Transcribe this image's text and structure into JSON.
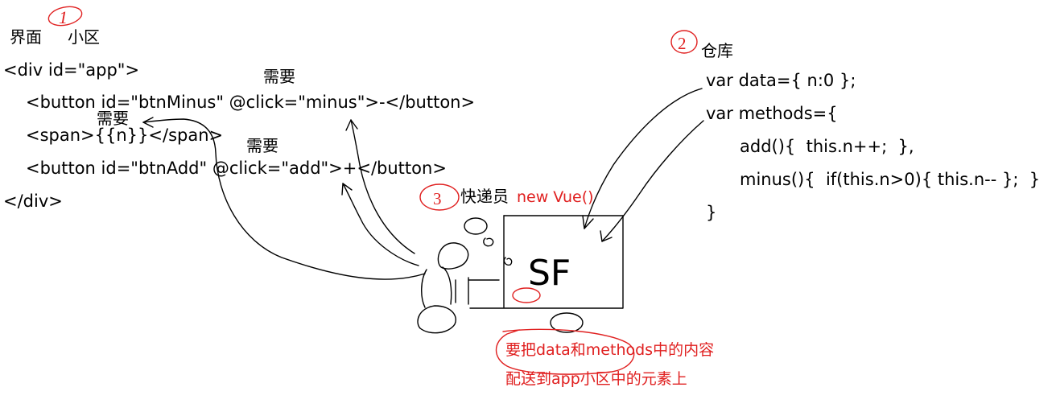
{
  "left": {
    "title_ui": "界面",
    "title_area": "小区",
    "code": [
      "<div id=\"app\">",
      "<button id=\"btnMinus\" @click=\"minus\">-</button>",
      "<span>{{n}}</span>",
      "<button id=\"btnAdd\" @click=\"add\">+</button>",
      "</div>"
    ],
    "need_labels": [
      "需要",
      "需要",
      "需要"
    ]
  },
  "right": {
    "title": "仓库",
    "code": [
      "var data={ n:0 };",
      "var methods={",
      "add(){  this.n++;  },",
      "minus(){  if(this.n>0){ this.n-- };  }",
      "}"
    ]
  },
  "courier": {
    "label": "快递员",
    "new_vue": "new Vue()",
    "box_text": "SF"
  },
  "note": {
    "line1": "要把data和methods中的内容",
    "line2": "配送到app小区中的元素上"
  },
  "circled_numbers": [
    "1",
    "2",
    "3"
  ],
  "colors": {
    "ink": "#000000",
    "red": "#e02020"
  }
}
